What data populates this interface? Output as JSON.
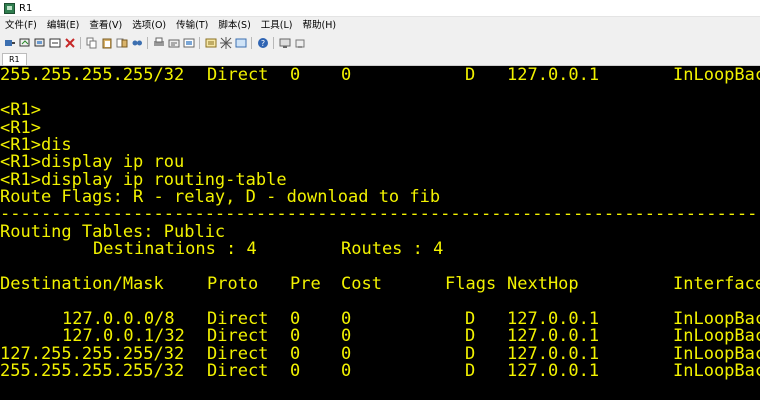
{
  "window": {
    "title": "R1",
    "accent": "#f2f200",
    "background": "#000000"
  },
  "menu": [
    "文件(F)",
    "编辑(E)",
    "查看(V)",
    "选项(O)",
    "传输(T)",
    "脚本(S)",
    "工具(L)",
    "帮助(H)"
  ],
  "toolbar_icons": [
    "connect-icon",
    "reconnect-icon",
    "disconnect-icon",
    "session-icon",
    "close-session-icon",
    "copy-icon",
    "paste-icon",
    "copy-paste-icon",
    "find-icon",
    "print-icon",
    "print-setup-icon",
    "settings-icon",
    "session-options-icon",
    "keymap-icon",
    "sftp-icon",
    "help-icon",
    "screen-icon",
    "misc-icon"
  ],
  "tab": {
    "label": "R1"
  },
  "terminal": {
    "top_row": [
      "255.255.255.255/32",
      "Direct",
      "0",
      "0",
      "D",
      "127.0.0.1",
      "InLoopBac"
    ],
    "prompts": [
      "<R1>",
      "<R1>",
      "<R1>dis",
      "<R1>display ip rou",
      "<R1>display ip routing-table"
    ],
    "flags_line": "Route Flags: R - relay, D - download to fib",
    "separator": "------------------------------------------------------------------------------",
    "routing_tables": "Routing Tables: Public",
    "destinations_label": "Destinations : 4",
    "routes_label": "Routes : 4",
    "headers": [
      "Destination/Mask",
      "Proto",
      "Pre",
      "Cost",
      "Flags",
      "NextHop",
      "Interface"
    ],
    "routes": [
      [
        "127.0.0.0/8",
        "Direct",
        "0",
        "0",
        "D",
        "127.0.0.1",
        "InLoopBac"
      ],
      [
        "127.0.0.1/32",
        "Direct",
        "0",
        "0",
        "D",
        "127.0.0.1",
        "InLoopBac"
      ],
      [
        "127.255.255.255/32",
        "Direct",
        "0",
        "0",
        "D",
        "127.0.0.1",
        "InLoopBac"
      ],
      [
        "255.255.255.255/32",
        "Direct",
        "0",
        "0",
        "D",
        "127.0.0.1",
        "InLoopBac"
      ]
    ]
  }
}
